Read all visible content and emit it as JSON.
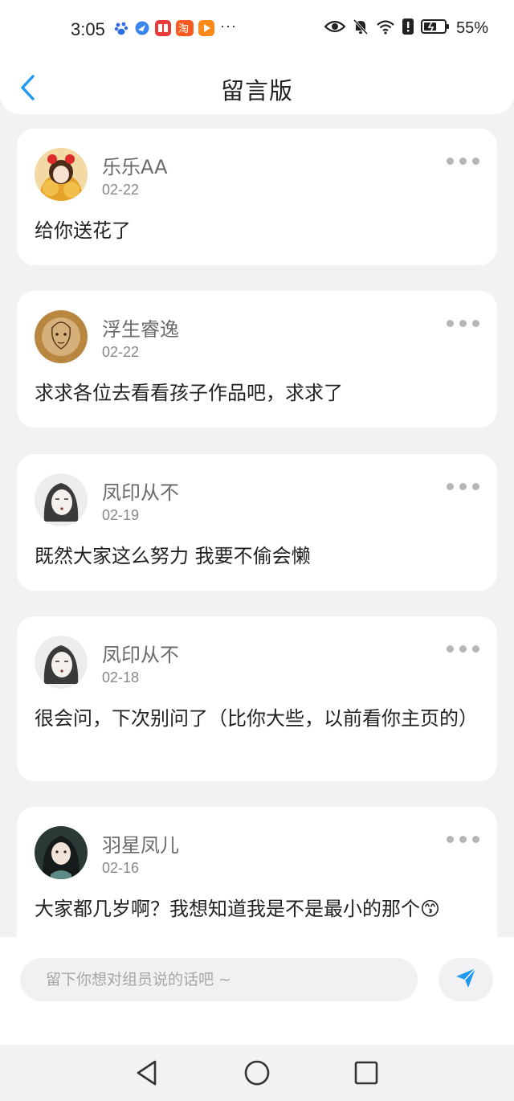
{
  "status_bar": {
    "time": "3:05",
    "more_notifications": "···",
    "battery_percent": "55%",
    "icons": [
      "baidu-icon",
      "browser-icon",
      "reader-icon",
      "taobao-icon",
      "video-icon",
      "eye-icon",
      "bell-muted-icon",
      "wifi-icon",
      "alert-icon",
      "battery-icon"
    ]
  },
  "header": {
    "title": "留言版",
    "back_icon": "chevron-left-icon"
  },
  "messages": [
    {
      "name": "乐乐AA",
      "date": "02-22",
      "text": "给你送花了"
    },
    {
      "name": "浮生睿逸",
      "date": "02-22",
      "text": "求求各位去看看孩子作品吧，求求了"
    },
    {
      "name": "凤印从不",
      "date": "02-19",
      "text": "既然大家这么努力 我要不偷会懒"
    },
    {
      "name": "凤印从不",
      "date": "02-18",
      "text": "很会问，下次别问了（比你大些，以前看你主页的）"
    },
    {
      "name": "羽星凤儿",
      "date": "02-16",
      "text": "大家都几岁啊？我想知道我是不是最小的那个😙"
    }
  ],
  "input": {
    "placeholder": "留下你想对组员说的话吧 ~",
    "value": ""
  },
  "colors": {
    "accent": "#1f9af0",
    "background": "#f2f2f4",
    "card": "#ffffff"
  }
}
